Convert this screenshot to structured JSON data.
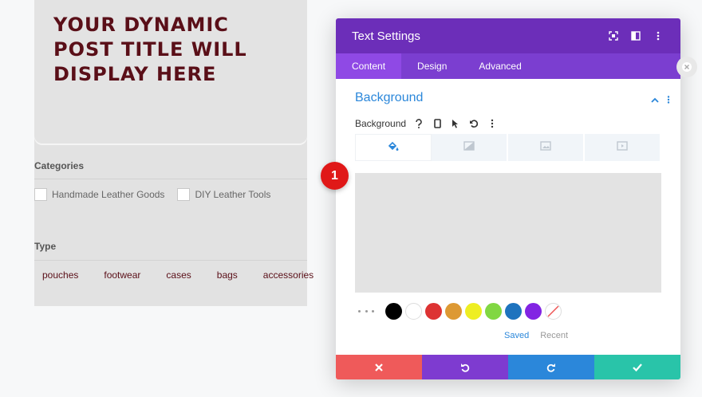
{
  "preview": {
    "post_title": "YOUR DYNAMIC POST TITLE WILL DISPLAY HERE",
    "categories_label": "Categories",
    "categories": [
      "Handmade Leather Goods",
      "DIY Leather Tools"
    ],
    "type_label": "Type",
    "tags": [
      "pouches",
      "footwear",
      "cases",
      "bags",
      "accessories"
    ]
  },
  "modal": {
    "title": "Text Settings",
    "header_icons": [
      "expand-icon",
      "split-view-icon",
      "more-vertical-icon"
    ],
    "tabs": [
      {
        "label": "Content",
        "active": true
      },
      {
        "label": "Design",
        "active": false
      },
      {
        "label": "Advanced",
        "active": false
      }
    ],
    "section_title": "Background",
    "field_label": "Background",
    "field_icons": [
      "help-icon",
      "mobile-icon",
      "cursor-icon",
      "reset-icon",
      "more-vertical-icon"
    ],
    "background_tabs": [
      "paint-bucket-icon",
      "gradient-icon",
      "image-icon",
      "video-icon"
    ],
    "swatches": [
      "#000000",
      "#ffffff",
      "#dd3333",
      "#dd9933",
      "#eeee22",
      "#81d742",
      "#1e73be",
      "#8224e3"
    ],
    "saved_label": "Saved",
    "recent_label": "Recent",
    "footer_colors": {
      "cancel": "#ef5a5a",
      "undo": "#7e3bd0",
      "redo": "#2b87da",
      "save": "#29c4a9"
    }
  },
  "step_badge": "1",
  "colors": {
    "accent": "#6c2eb9",
    "link": "#2b87da",
    "title": "#5a0f18"
  }
}
